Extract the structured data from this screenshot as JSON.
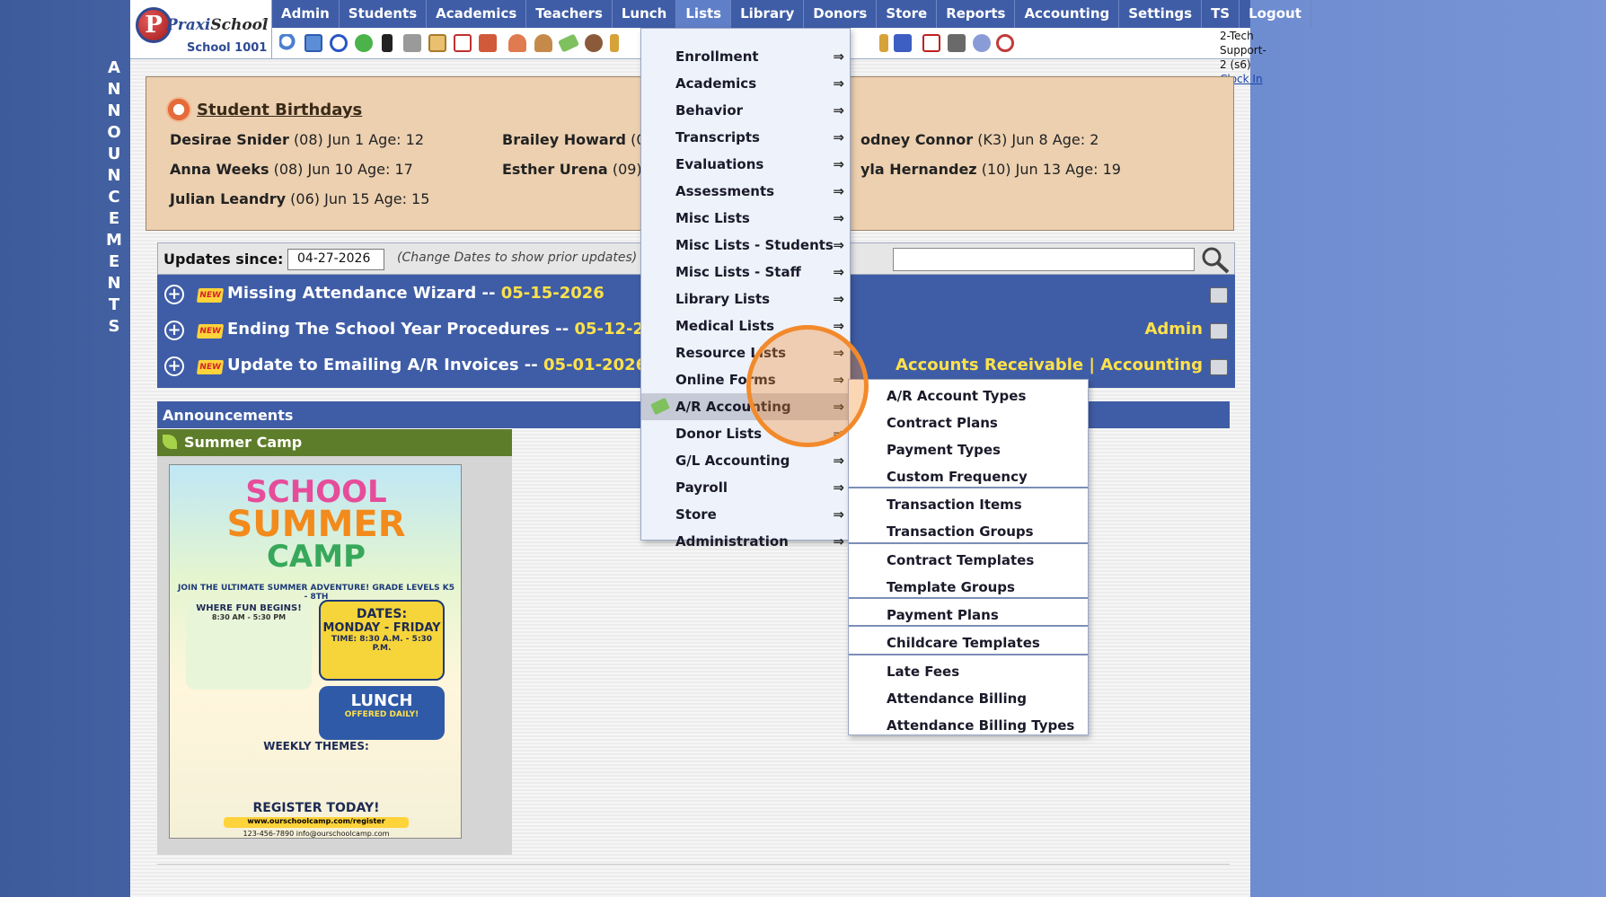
{
  "side_banner": [
    "A",
    "N",
    "N",
    "O",
    "U",
    "N",
    "C",
    "E",
    "M",
    "E",
    "N",
    "T",
    "S"
  ],
  "logo": {
    "name_part1": "Praxi",
    "name_part2": "School",
    "tm": "™",
    "school": "School 1001",
    "letter": "P"
  },
  "nav": [
    "Admin",
    "Students",
    "Academics",
    "Teachers",
    "Lunch",
    "Lists",
    "Library",
    "Donors",
    "Store",
    "Reports",
    "Accounting",
    "Settings",
    "TS",
    "Logout"
  ],
  "user": {
    "name": "2-Tech Support-2 (s6)",
    "clock": "Clock In"
  },
  "birthdays": {
    "title": "Student Birthdays",
    "entries": [
      {
        "name": "Desirae Snider",
        "detail": "(08) Jun 1 Age: 12"
      },
      {
        "name": "Brailey Howard",
        "detail": "(0"
      },
      {
        "name": "odney Connor",
        "detail": "(K3) Jun 8 Age: 2"
      },
      {
        "name": "Anna Weeks",
        "detail": "(08) Jun 10 Age: 17"
      },
      {
        "name": "Esther Urena",
        "detail": "(09) ."
      },
      {
        "name": "yla Hernandez",
        "detail": "(10) Jun 13 Age: 19"
      },
      {
        "name": "Julian Leandry",
        "detail": "(06) Jun 15 Age: 15"
      }
    ]
  },
  "updates": {
    "label": "Updates since:",
    "date": "04-27-2026",
    "note": "(Change Dates to show prior updates)",
    "badge": "NEW",
    "rows": [
      {
        "title": "Missing Attendance Wizard -- ",
        "date": "05-15-2026",
        "links": ""
      },
      {
        "title": "Ending The School Year Procedures -- ",
        "date": "05-12-2026",
        "links": "Admin"
      },
      {
        "title": "Update to Emailing A/R Invoices -- ",
        "date": "05-01-2026",
        "links": "Accounts Receivable  |  Accounting"
      }
    ]
  },
  "announcements": {
    "bar": "Announcements",
    "item": "Summer Camp"
  },
  "flyer": {
    "line1": "SCHOOL",
    "line2": "SUMMER",
    "line3": "CAMP",
    "subtitle": "JOIN THE ULTIMATE SUMMER ADVENTURE! GRADE LEVELS K5 - 8TH",
    "where": "WHERE FUN BEGINS!",
    "where_time": "8:30 AM - 5:30 PM",
    "dates_title": "DATES:",
    "dates_days": "MONDAY - FRIDAY",
    "dates_time": "TIME: 8:30 A.M. - 5:30 P.M.",
    "lunch": "LUNCH",
    "lunch_sub": "OFFERED DAILY!",
    "themes": "WEEKLY THEMES:",
    "register": "REGISTER TODAY!",
    "url": "www.ourschoolcamp.com/register",
    "contact": "123-456-7890   info@ourschoolcamp.com"
  },
  "lists_menu": {
    "arrow": "⇒",
    "items": [
      "Enrollment",
      "Academics",
      "Behavior",
      "Transcripts",
      "Evaluations",
      "Assessments",
      "Misc Lists",
      "Misc Lists - Students",
      "Misc Lists - Staff",
      "Library Lists",
      "Medical Lists",
      "Resource Lists",
      "Online Forms",
      "A/R Accounting",
      "Donor Lists",
      "G/L Accounting",
      "Payroll",
      "Store",
      "Administration"
    ],
    "highlighted": "A/R Accounting"
  },
  "ar_submenu": [
    "A/R Account Types",
    "Contract Plans",
    "Payment Types",
    "Custom Frequency",
    "Transaction Items",
    "Transaction Groups",
    "Contract Templates",
    "Template Groups",
    "Payment Plans",
    "Childcare Templates",
    "Late Fees",
    "Attendance Billing",
    "Attendance Billing Types"
  ],
  "colors": {
    "nav": "#3f5da6",
    "accent_yellow": "#ffe24a",
    "birthday_bg": "#ecd0b0",
    "click_ring": "#f28a2b"
  }
}
